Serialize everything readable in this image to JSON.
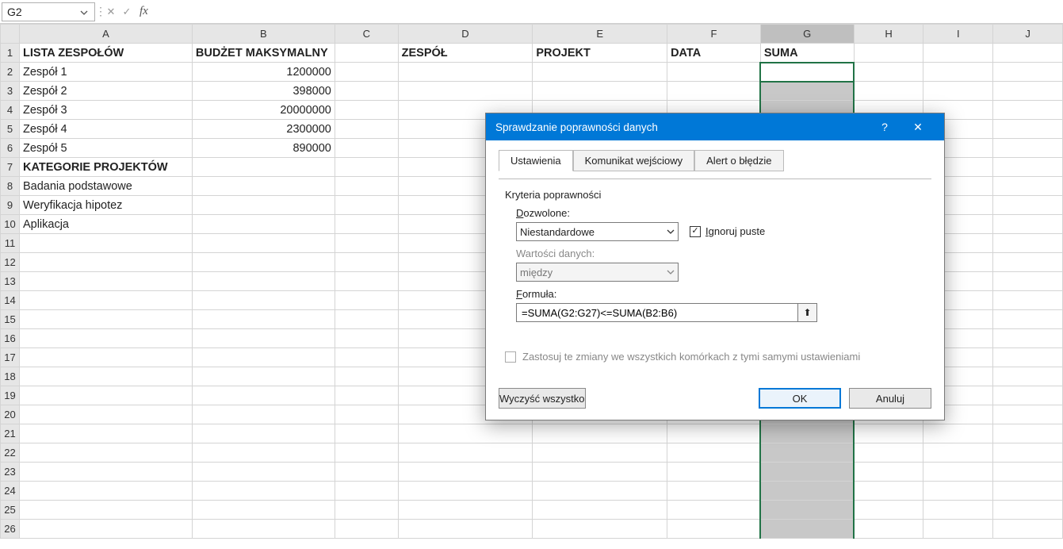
{
  "namebox": {
    "value": "G2"
  },
  "fx": {
    "cancel": "✕",
    "accept": "✓",
    "label": "fx",
    "value": ""
  },
  "columns": [
    "A",
    "B",
    "C",
    "D",
    "E",
    "F",
    "G",
    "H",
    "I",
    "J"
  ],
  "rows": [
    1,
    2,
    3,
    4,
    5,
    6,
    7,
    8,
    9,
    10,
    11,
    12,
    13,
    14,
    15,
    16,
    17,
    18,
    19,
    20,
    21,
    22,
    23,
    24,
    25,
    26
  ],
  "headers": {
    "A": "LISTA ZESPOŁÓW",
    "B": "BUDŻET MAKSYMALNY",
    "D": "ZESPÓŁ",
    "E": "PROJEKT",
    "F": "DATA",
    "G": "SUMA"
  },
  "teams": [
    {
      "name": "Zespół 1",
      "budget": "1200000"
    },
    {
      "name": "Zespół 2",
      "budget": "398000"
    },
    {
      "name": "Zespół 3",
      "budget": "20000000"
    },
    {
      "name": "Zespół 4",
      "budget": "2300000"
    },
    {
      "name": "Zespół 5",
      "budget": "890000"
    }
  ],
  "section2_title": "KATEGORIE PROJEKTÓW",
  "categories": [
    "Badania podstawowe",
    "Weryfikacja hipotez",
    "Aplikacja"
  ],
  "dialog": {
    "title": "Sprawdzanie poprawności danych",
    "help": "?",
    "close": "✕",
    "tabs": {
      "settings": "Ustawienia",
      "input_msg": "Komunikat wejściowy",
      "error_alert": "Alert o błędzie"
    },
    "criteria_label": "Kryteria poprawności",
    "allow_label": "Dozwolone:",
    "allow_value": "Niestandardowe",
    "ignore_blank": "Ignoruj puste",
    "data_label": "Wartości danych:",
    "data_value": "między",
    "formula_label": "Formuła:",
    "formula_value": "=SUMA(G2:G27)<=SUMA(B2:B6)",
    "apply_all": "Zastosuj te zmiany we wszystkich komórkach z tymi samymi ustawieniami",
    "clear": "Wyczyść wszystko",
    "ok": "OK",
    "cancel": "Anuluj"
  }
}
